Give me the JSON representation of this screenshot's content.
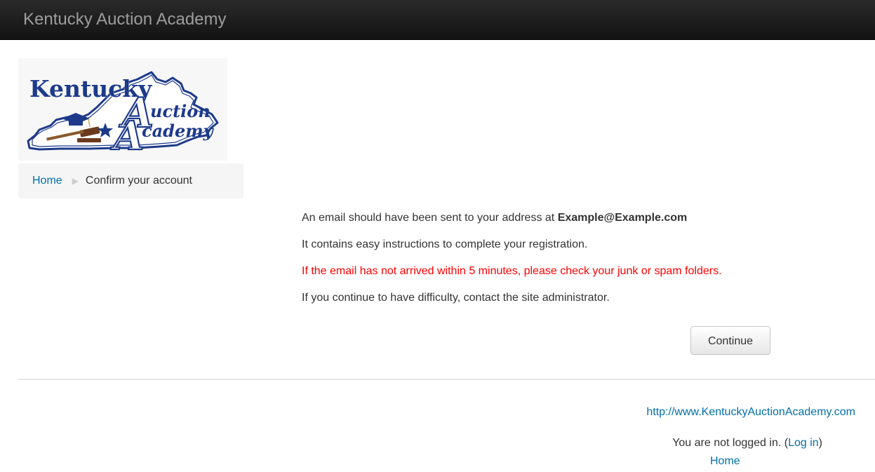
{
  "header": {
    "site_title": "Kentucky Auction Academy"
  },
  "logo": {
    "word1": "Kentucky",
    "word2": "uction",
    "word3": "cademy",
    "cap_letter_a": "A",
    "cap_letter_b": "A"
  },
  "breadcrumb": {
    "home": "Home",
    "current": "Confirm your account"
  },
  "main": {
    "line1_prefix": "An email should have been sent to your address at",
    "email": "Example@Example.com",
    "line2": "It contains easy instructions to complete your registration.",
    "line3": "If the email has not arrived within 5 minutes, please check your junk or spam folders.",
    "line4": "If you continue to have difficulty, contact the site administrator.",
    "continue_label": "Continue"
  },
  "footer": {
    "url": "http://www.KentuckyAuctionAcademy.com",
    "not_logged_in": "You are not logged in.",
    "login_label": "Log in",
    "home_label": "Home"
  },
  "colors": {
    "header_bg": "#1b1b1b",
    "header_text": "#9d9d9d",
    "link": "#0070a8",
    "warning": "#ff0000",
    "logo_blue": "#1d3a8a"
  }
}
